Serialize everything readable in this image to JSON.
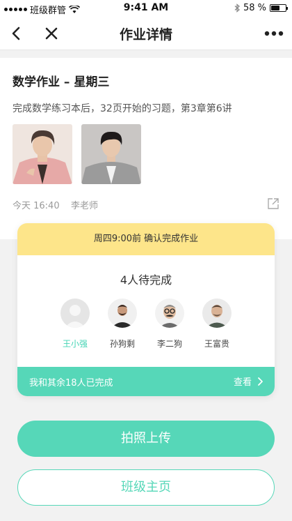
{
  "status_bar": {
    "carrier": "班级群管",
    "time": "9:41 AM",
    "battery": "58 %",
    "battery_level": 0.58,
    "icons": [
      "signal-dots-icon",
      "wifi-icon",
      "bluetooth-icon",
      "battery-icon"
    ]
  },
  "nav": {
    "title": "作业详情",
    "icons": [
      "back-icon",
      "close-icon",
      "more-icon"
    ]
  },
  "post": {
    "title": "数学作业 – 星期三",
    "body": "完成数学练习本后，32页开始的习题，第3章第6讲",
    "time": "今天 16:40",
    "teacher": "李老师"
  },
  "status_card": {
    "header": "周四9:00前 确认完成作业",
    "pending": "4人待完成",
    "students": [
      {
        "name": "王小强",
        "highlighted": true
      },
      {
        "name": "孙狗剩",
        "highlighted": false
      },
      {
        "name": "李二狗",
        "highlighted": false
      },
      {
        "name": "王富贵",
        "highlighted": false
      }
    ],
    "footer_text": "我和其余18人已完成",
    "footer_action": "查看"
  },
  "buttons": {
    "upload": "拍照上传",
    "class_home": "班级主页"
  },
  "colors": {
    "accent": "#56d7b8",
    "header_yellow": "#fde58a",
    "highlight_name": "#44d4b4"
  }
}
